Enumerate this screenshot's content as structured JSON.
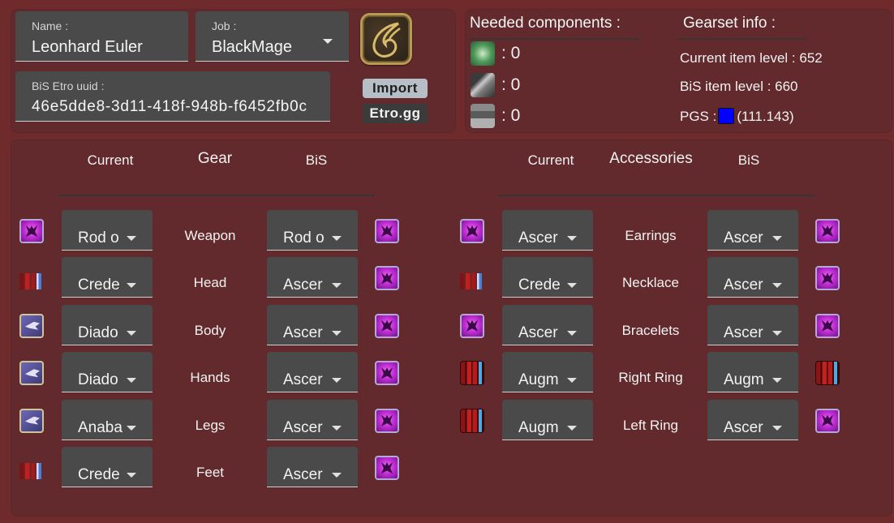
{
  "character": {
    "name_label": "Name :",
    "name_value": "Leonhard Euler",
    "job_label": "Job :",
    "job_value": "BlackMage",
    "uuid_label": "BiS Etro uuid :",
    "uuid_value": "46e5dde8-3d11-418f-948b-f6452fb0c",
    "job_icon": "black-mage-job-icon",
    "import_label": "Import",
    "etro_label": "Etro.gg"
  },
  "components": {
    "heading": "Needed components :",
    "items": [
      {
        "icon": "twine-icon",
        "value": ": 0"
      },
      {
        "icon": "shine-icon",
        "value": ": 0"
      },
      {
        "icon": "coating-icon",
        "value": ": 0"
      }
    ]
  },
  "gearset": {
    "heading": "Gearset info :",
    "current_ilvl": "Current item level : 652",
    "bis_ilvl": "BiS item level : 660",
    "pgs_label": "PGS :",
    "pgs_value": "(111.143)",
    "pgs_color": "#0000ff"
  },
  "gear": {
    "title": "Gear",
    "current_label": "Current",
    "bis_label": "BiS",
    "rows": [
      {
        "slot": "Weapon",
        "current": "Rod o",
        "bis": "Rod o",
        "current_icon": "purple",
        "bis_icon": "purple"
      },
      {
        "slot": "Head",
        "current": "Crede",
        "bis": "Ascer",
        "current_icon": "crede",
        "bis_icon": "purple"
      },
      {
        "slot": "Body",
        "current": "Diado",
        "bis": "Ascer",
        "current_icon": "diadem",
        "bis_icon": "purple"
      },
      {
        "slot": "Hands",
        "current": "Diado",
        "bis": "Ascer",
        "current_icon": "diadem",
        "bis_icon": "purple"
      },
      {
        "slot": "Legs",
        "current": "Anaba",
        "bis": "Ascer",
        "current_icon": "diadem",
        "bis_icon": "purple"
      },
      {
        "slot": "Feet",
        "current": "Crede",
        "bis": "Ascer",
        "current_icon": "crede",
        "bis_icon": "purple"
      }
    ]
  },
  "accessories": {
    "title": "Accessories",
    "current_label": "Current",
    "bis_label": "BiS",
    "rows": [
      {
        "slot": "Earrings",
        "current": "Ascer",
        "bis": "Ascer",
        "current_icon": "purple",
        "bis_icon": "purple"
      },
      {
        "slot": "Necklace",
        "current": "Crede",
        "bis": "Ascer",
        "current_icon": "crede",
        "bis_icon": "purple"
      },
      {
        "slot": "Bracelets",
        "current": "Ascer",
        "bis": "Ascer",
        "current_icon": "purple",
        "bis_icon": "purple"
      },
      {
        "slot": "Right Ring",
        "current": "Augm",
        "bis": "Augm",
        "current_icon": "augm",
        "bis_icon": "augm"
      },
      {
        "slot": "Left Ring",
        "current": "Augm",
        "bis": "Ascer",
        "current_icon": "augm",
        "bis_icon": "purple"
      }
    ]
  }
}
